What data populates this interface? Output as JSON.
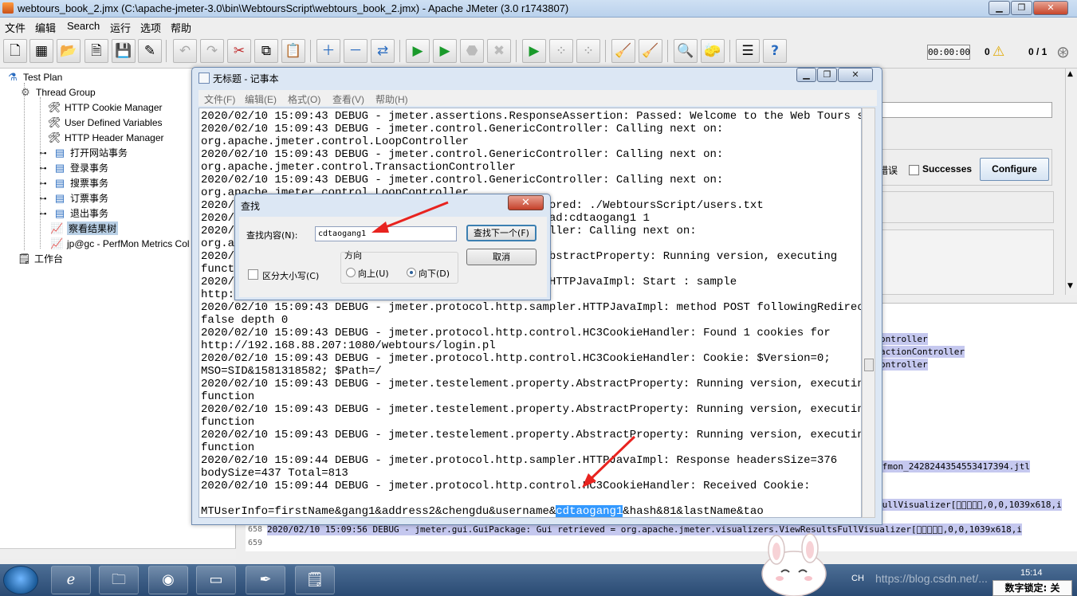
{
  "jmeter": {
    "title": "webtours_book_2.jmx (C:\\apache-jmeter-3.0\\bin\\WebtoursScript\\webtours_book_2.jmx) - Apache JMeter (3.0 r1743807)",
    "menu": [
      "文件",
      "编辑",
      "Search",
      "运行",
      "选项",
      "帮助"
    ],
    "timer": "00:00:00",
    "error_count": "0",
    "threads": "0 / 1",
    "tree": [
      {
        "label": "Test Plan",
        "icon": "test-plan-icon"
      },
      {
        "label": "Thread Group",
        "icon": "gear-icon"
      },
      {
        "label": "HTTP Cookie Manager",
        "icon": "wrench-icon"
      },
      {
        "label": "User Defined Variables",
        "icon": "wrench-icon"
      },
      {
        "label": "HTTP Header Manager",
        "icon": "wrench-icon"
      },
      {
        "label": "打开网站事务",
        "icon": "controller-icon"
      },
      {
        "label": "登录事务",
        "icon": "controller-icon"
      },
      {
        "label": "搜票事务",
        "icon": "controller-icon"
      },
      {
        "label": "订票事务",
        "icon": "controller-icon"
      },
      {
        "label": "退出事务",
        "icon": "controller-icon"
      },
      {
        "label": "察看结果树",
        "icon": "listener-icon"
      },
      {
        "label": "jp@gc - PerfMon Metrics Col",
        "icon": "chart-icon"
      },
      {
        "label": "工作台",
        "icon": "workbench-icon"
      }
    ],
    "right_panel": {
      "errors_label": "错误",
      "successes_label": "Successes",
      "configure_label": "Configure"
    },
    "log_highlights": [
      "ontroller",
      "actionController",
      "ontroller",
      "rfmon_2428244354553417394.jtl",
      "FullVisualizer[\u0000\u0000\u0000\u0000\u0000,0,0,1039x618,i",
      "FullVisualizer[\u0000\u0000\u0000\u0000\u0000,0,0,1039x618,i"
    ],
    "log_bottom": [
      {
        "num": "658",
        "text": "2020/02/10 15:09:56 DEBUG - jmeter.gui.GuiPackage: Gui retrieved = org.apache.jmeter.visualizers.ViewResultsFullVisualizer[\u0000\u0000\u0000\u0000\u0000,0,0,1039x618,i"
      },
      {
        "num": "659",
        "text": ""
      }
    ]
  },
  "notepad": {
    "title": "无标题 - 记事本",
    "menu": [
      "文件(F)",
      "编辑(E)",
      "格式(O)",
      "查看(V)",
      "帮助(H)"
    ],
    "lines": [
      "2020/02/10 15:09:43 DEBUG - jmeter.assertions.ResponseAssertion: Passed: Welcome to the Web Tours site",
      "2020/02/10 15:09:43 DEBUG - jmeter.control.GenericController: Calling next on:",
      "org.apache.jmeter.control.LoopController",
      "2020/02/10 15:09:43 DEBUG - jmeter.control.GenericController: Calling next on:",
      "org.apache.jmeter.control.TransactionController",
      "2020/02/10 15:09:43 DEBUG - jmeter.control.GenericController: Calling next on:",
      "org.apache.jmeter.control.LoopController",
      "2020/                                             Stored: ./WebtoursScript/users.txt",
      "2020/                                             Read:cdtaogang1 1",
      "2020/                                             roller: Calling next on:",
      "org.ap",
      "2020/                                             .AbstractProperty: Running version, executing",
      "funct",
      "2020/                                             r.HTTPJavaImpl: Start : sample",
      "http:",
      "2020/02/10 15:09:43 DEBUG - jmeter.protocol.http.sampler.HTTPJavaImpl: method POST followingRedirect",
      "false depth 0",
      "2020/02/10 15:09:43 DEBUG - jmeter.protocol.http.control.HC3CookieHandler: Found 1 cookies for",
      "http://192.168.88.207:1080/webtours/login.pl",
      "2020/02/10 15:09:43 DEBUG - jmeter.protocol.http.control.HC3CookieHandler: Cookie: $Version=0;",
      "MSO=SID&1581318582; $Path=/",
      "2020/02/10 15:09:43 DEBUG - jmeter.testelement.property.AbstractProperty: Running version, executing",
      "function",
      "2020/02/10 15:09:43 DEBUG - jmeter.testelement.property.AbstractProperty: Running version, executing",
      "function",
      "2020/02/10 15:09:43 DEBUG - jmeter.testelement.property.AbstractProperty: Running version, executing",
      "function",
      "2020/02/10 15:09:44 DEBUG - jmeter.protocol.http.sampler.HTTPJavaImpl: Response headersSize=376",
      "bodySize=437 Total=813",
      "2020/02/10 15:09:44 DEBUG - jmeter.protocol.http.control.HC3CookieHandler: Received Cookie:"
    ],
    "last_line_before": "MTUserInfo=firstName&gang1&address2&chengdu&username&",
    "last_line_selected": "cdtaogang1",
    "last_line_after": "&hash&81&lastName&tao"
  },
  "find_dialog": {
    "title": "查找",
    "find_label": "查找内容(N):",
    "find_value": "cdtaogang1",
    "find_next_label": "查找下一个(F)",
    "cancel_label": "取消",
    "direction_label": "方向",
    "up_label": "向上(U)",
    "down_label": "向下(D)",
    "match_case_label": "区分大小写(C)",
    "direction_selected": "down"
  },
  "taskbar": {
    "lang": "CH",
    "clock": "15:14",
    "ime_status": "数字锁定: 关",
    "watermark": "https://blog.csdn.net/..."
  },
  "colors": {
    "selection": "#3399ff",
    "arrow": "#e8231f",
    "log_highlight": "#c5c8ef"
  }
}
